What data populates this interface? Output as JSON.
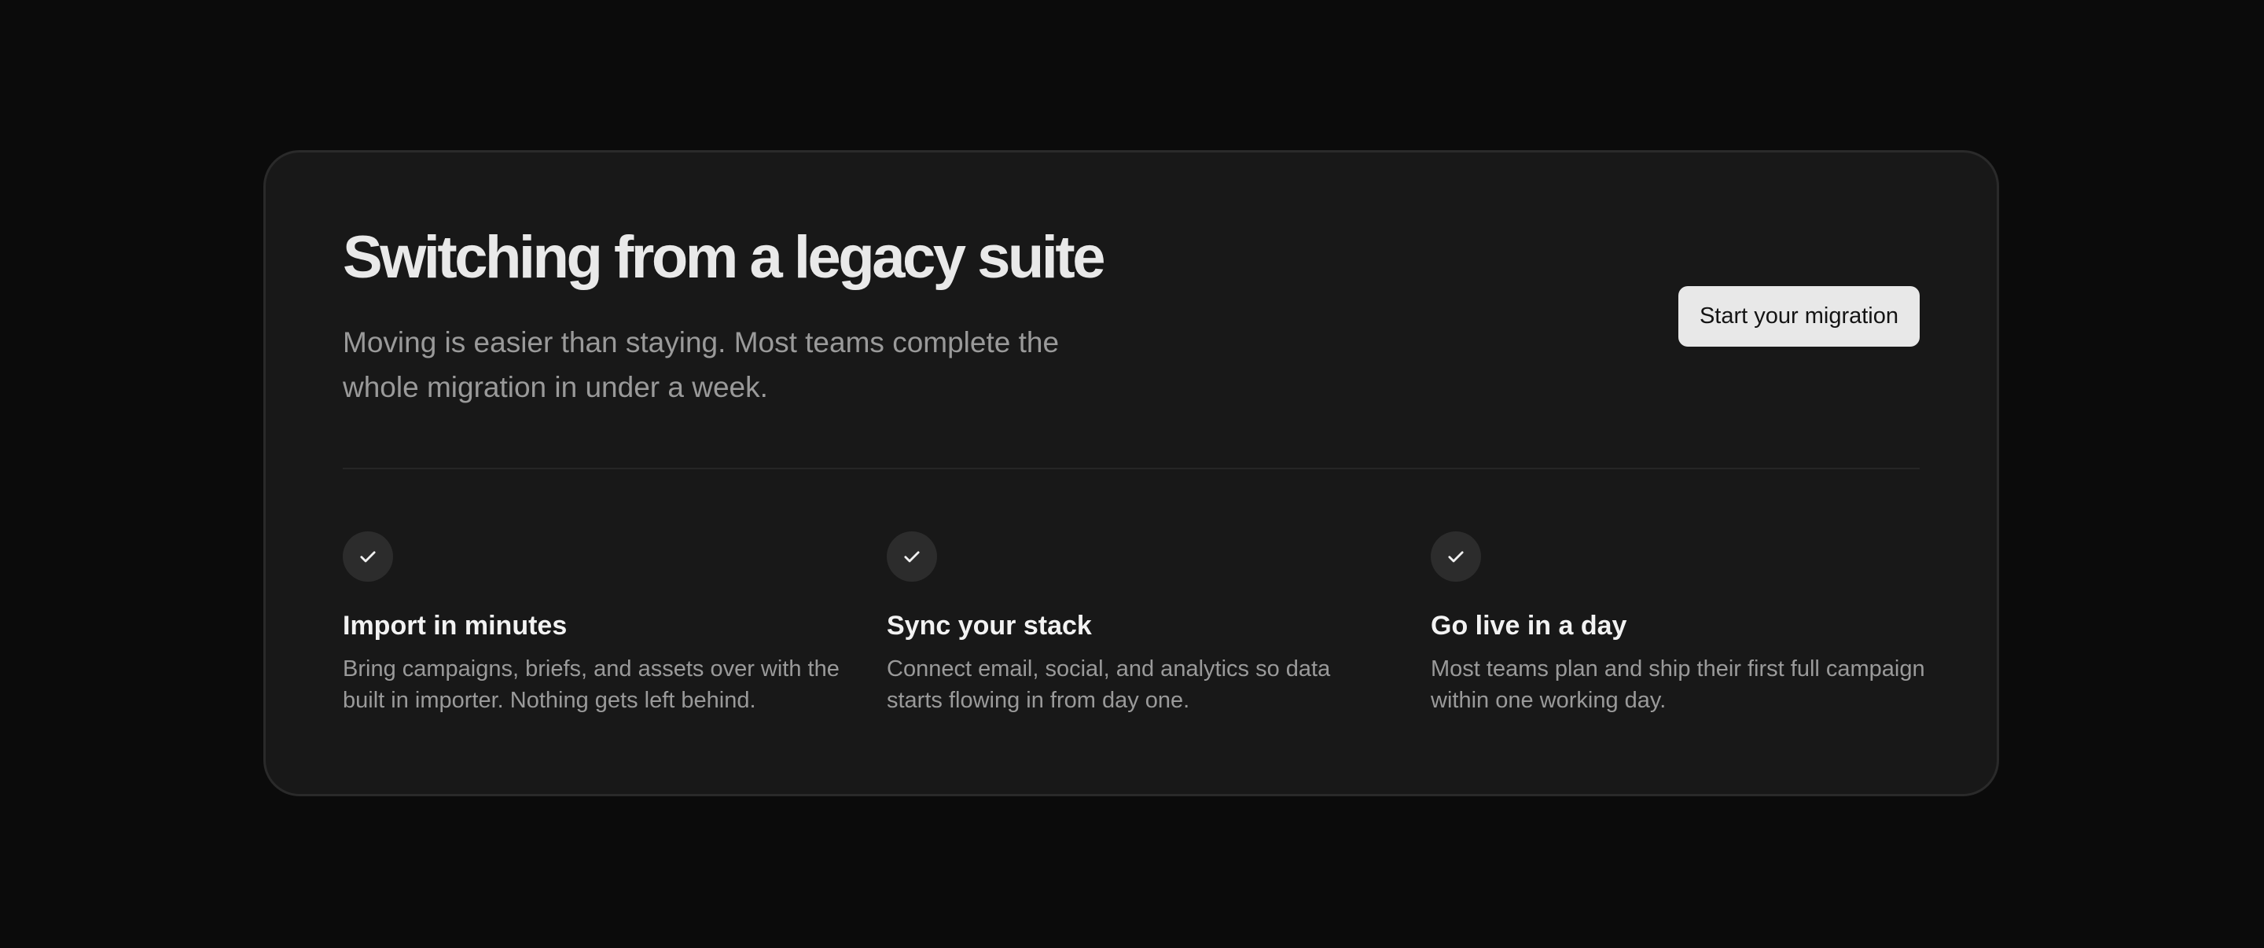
{
  "section": {
    "title": "Switching from a legacy suite",
    "subtitle": "Moving is easier than staying. Most teams complete the whole migration in under a week.",
    "cta_label": "Start your migration"
  },
  "features": [
    {
      "icon": "check-icon",
      "title": "Import in minutes",
      "description": "Bring campaigns, briefs, and assets over with the built in importer. Nothing gets left behind."
    },
    {
      "icon": "check-icon",
      "title": "Sync your stack",
      "description": "Connect email, social, and analytics so data starts flowing in from day one."
    },
    {
      "icon": "check-icon",
      "title": "Go live in a day",
      "description": "Most teams plan and ship their first full campaign within one working day."
    }
  ],
  "colors": {
    "page_background": "#0b0b0b",
    "card_background": "#181818",
    "card_border": "#2a2a2a",
    "title_text": "#e9e9e9",
    "muted_text": "#9a9a9a",
    "button_background": "#e8e8e8",
    "button_text": "#141414",
    "icon_background": "#2c2c2c"
  }
}
